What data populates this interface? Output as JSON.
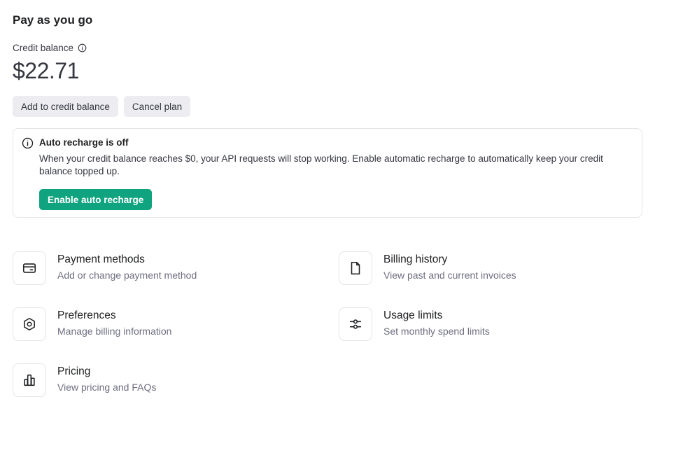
{
  "plan": {
    "title": "Pay as you go"
  },
  "credit": {
    "label": "Credit balance",
    "info_icon": "info-icon",
    "amount": "$22.71"
  },
  "actions": {
    "add_credit": "Add to credit balance",
    "cancel_plan": "Cancel plan"
  },
  "auto_recharge": {
    "icon": "info-icon",
    "title": "Auto recharge is off",
    "body": "When your credit balance reaches $0, your API requests will stop working. Enable automatic recharge to automatically keep your credit balance topped up.",
    "button": "Enable auto recharge",
    "button_color": "#10a37f"
  },
  "tiles": [
    {
      "icon": "credit-card-icon",
      "title": "Payment methods",
      "desc": "Add or change payment method"
    },
    {
      "icon": "document-icon",
      "title": "Billing history",
      "desc": "View past and current invoices"
    },
    {
      "icon": "gear-icon",
      "title": "Preferences",
      "desc": "Manage billing information"
    },
    {
      "icon": "sliders-icon",
      "title": "Usage limits",
      "desc": "Set monthly spend limits"
    },
    {
      "icon": "bar-chart-icon",
      "title": "Pricing",
      "desc": "View pricing and FAQs"
    }
  ]
}
